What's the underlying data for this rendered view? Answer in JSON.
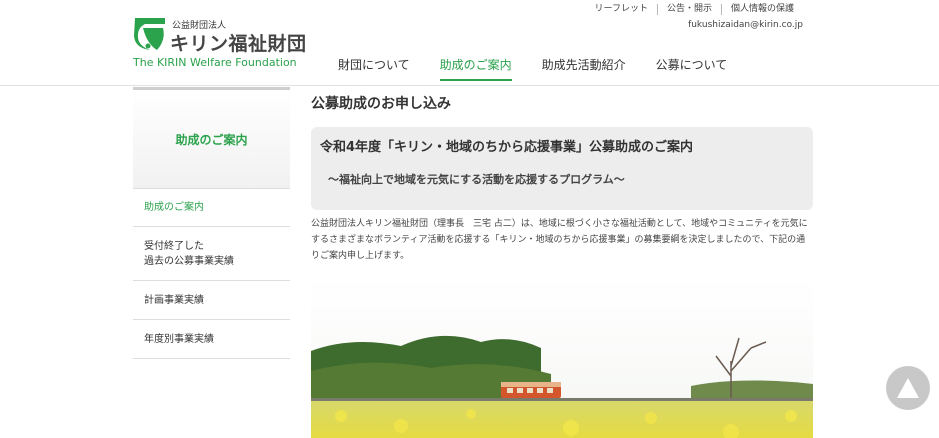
{
  "logo": {
    "org_type": "公益財団法人",
    "name": "キリン福祉財団",
    "english": "The KIRIN Welfare Foundation"
  },
  "util_nav": [
    "リーフレット",
    "公告・開示",
    "個人情報の保護"
  ],
  "email": "fukushizaidan@kirin.co.jp",
  "main_nav": [
    {
      "label": "財団について",
      "active": false
    },
    {
      "label": "助成のご案内",
      "active": true
    },
    {
      "label": "助成先活動紹介",
      "active": false
    },
    {
      "label": "公募について",
      "active": false
    }
  ],
  "sidebar": {
    "heading": "助成のご案内",
    "items": [
      {
        "label": "助成のご案内",
        "active": true
      },
      {
        "label": "受付終了した\n過去の公募事業実績",
        "active": false
      },
      {
        "label": "計画事業実績",
        "active": false
      },
      {
        "label": "年度別事業実績",
        "active": false
      }
    ]
  },
  "content": {
    "page_title": "公募助成のお申し込み",
    "notice_title": "令和4年度「キリン・地域のちから応援事業」公募助成のご案内",
    "notice_subtitle": "～福祉向上で地域を元気にする活動を応援するプログラム～",
    "intro": "公益財団法人キリン福祉財団（理事長　三宅 占二）は、地域に根づく小さな福祉活動として、地域やコミュニティを元気にするさまざまなボランティア活動を応援する「キリン・地域のちから応援事業」の募集要綱を決定しましたので、下記の通りご案内申し上げます。"
  },
  "colors": {
    "brand_green": "#2ba24c",
    "notice_bg": "#ededed",
    "scroll_button": "#c8c8c8"
  },
  "icons": {
    "logo_mark": "kirin-logo-icon",
    "to_top": "arrow-up-icon"
  }
}
